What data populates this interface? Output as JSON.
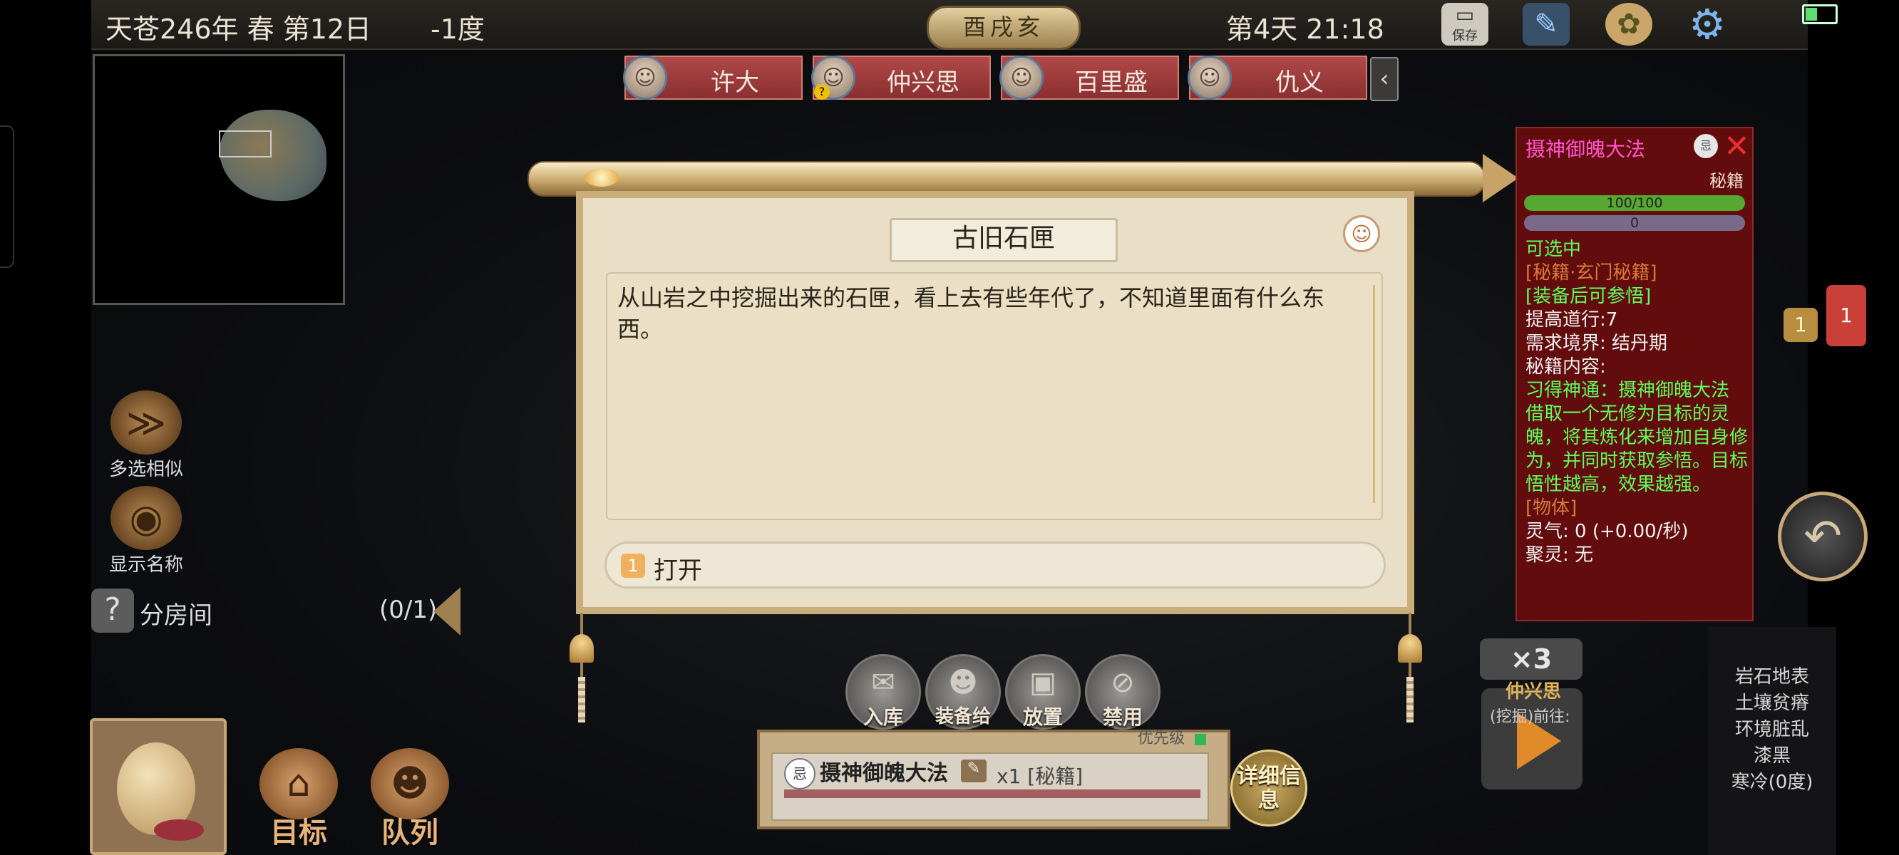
{
  "topbar": {
    "date": "天苍246年 春 第12日",
    "temperature": "-1度",
    "period": "酉戌亥",
    "day_time": "第4天 21:18",
    "save_label": "保存"
  },
  "side": {
    "multi_select": "多选相似",
    "show_names": "显示名称",
    "room_label": "分房间",
    "room_count": "(0/1)"
  },
  "bottom_left": {
    "target": "目标",
    "queue": "队列"
  },
  "characters": [
    {
      "name": "许大"
    },
    {
      "name": "仲兴思",
      "badge": "?"
    },
    {
      "name": "百里盛"
    },
    {
      "name": "仇义"
    }
  ],
  "dialog": {
    "title": "古旧石匣",
    "description": "从山岩之中挖掘出来的石匣，看上去有些年代了，不知道里面有什么东西。",
    "action_index": "1",
    "action_label": "打开"
  },
  "actions": [
    {
      "label": "入库"
    },
    {
      "label": "装备给予"
    },
    {
      "label": "放置"
    },
    {
      "label": "禁用"
    }
  ],
  "selected_item": {
    "name": "摄神御魄大法",
    "quantity": "x1 [秘籍]",
    "priority_label": "优先级",
    "detail_label": "详细信息"
  },
  "tooltip": {
    "title": "摄神御魄大法",
    "subtitle": "秘籍",
    "bar1": "100/100",
    "bar2": "0",
    "lines": [
      {
        "text": "可选中",
        "color": "#5cff5c"
      },
      {
        "text": "[秘籍·玄门秘籍]",
        "color": "#d87a3a"
      },
      {
        "text": "[装备后可参悟]",
        "color": "#5cff5c"
      },
      {
        "text": "提高道行:7",
        "color": "#f0f0f0"
      },
      {
        "text": "需求境界: 结丹期",
        "color": "#f0f0f0"
      },
      {
        "text": "秘籍内容:",
        "color": "#f0f0f0"
      },
      {
        "text": "习得神通：摄神御魄大法",
        "color": "#5cff5c"
      },
      {
        "text": "借取一个无修为目标的灵魄，将其炼化来增加自身修为，并同时获取参悟。目标悟性越高，效果越强。",
        "color": "#5cff5c"
      },
      {
        "text": "[物体]",
        "color": "#d87a3a"
      },
      {
        "text": "灵气: 0 (+0.00/秒)",
        "color": "#f0f0f0"
      },
      {
        "text": "聚灵: 无",
        "color": "#f0f0f0"
      }
    ]
  },
  "right": {
    "chat_count_1": "1",
    "chat_count_2": "1",
    "speed": "×3",
    "play_name": "仲兴思",
    "play_task": "(挖掘)前往:",
    "env": [
      "岩石地表",
      "土壤贫瘠",
      "环境脏乱",
      "漆黑",
      "寒冷(0度)"
    ]
  },
  "colors": {
    "tooltip_bg": "#620c0e",
    "tab_red": "#a03a3c",
    "paper": "#e9dfc6"
  }
}
